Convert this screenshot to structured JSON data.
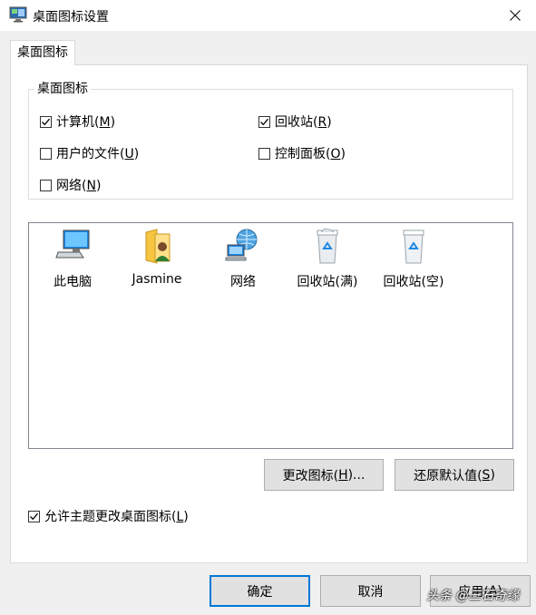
{
  "window": {
    "title": "桌面图标设置",
    "close_glyph": "✕"
  },
  "tabs": [
    {
      "label": "桌面图标",
      "selected": true
    }
  ],
  "group": {
    "title": "桌面图标",
    "checkboxes": [
      {
        "label_pre": "计算机(",
        "key": "M",
        "label_post": ")",
        "checked": true
      },
      {
        "label_pre": "回收站(",
        "key": "R",
        "label_post": ")",
        "checked": true
      },
      {
        "label_pre": "用户的文件(",
        "key": "U",
        "label_post": ")",
        "checked": false
      },
      {
        "label_pre": "控制面板(",
        "key": "O",
        "label_post": ")",
        "checked": false
      },
      {
        "label_pre": "网络(",
        "key": "N",
        "label_post": ")",
        "checked": false
      }
    ]
  },
  "icon_list": [
    {
      "label": "此电脑",
      "icon": "computer-icon"
    },
    {
      "label": "Jasmine",
      "icon": "user-folder-icon"
    },
    {
      "label": "网络",
      "icon": "network-icon"
    },
    {
      "label": "回收站(满)",
      "icon": "recycle-bin-full-icon"
    },
    {
      "label": "回收站(空)",
      "icon": "recycle-bin-empty-icon"
    }
  ],
  "buttons": {
    "change_icon": {
      "pre": "更改图标(",
      "key": "H",
      "post": ")..."
    },
    "restore_default": {
      "pre": "还原默认值(",
      "key": "S",
      "post": ")"
    },
    "ok": "确定",
    "cancel": "取消",
    "apply": {
      "pre": "应用(",
      "key": "A",
      "post": ")"
    }
  },
  "allow_themes": {
    "pre": "允许主题更改桌面图标(",
    "key": "L",
    "post": ")",
    "checked": true
  },
  "watermark": "头条 @三石奇缘",
  "colors": {
    "accent": "#0078d7",
    "panel_border": "#d9d9d9",
    "button_face": "#e1e1e1"
  }
}
